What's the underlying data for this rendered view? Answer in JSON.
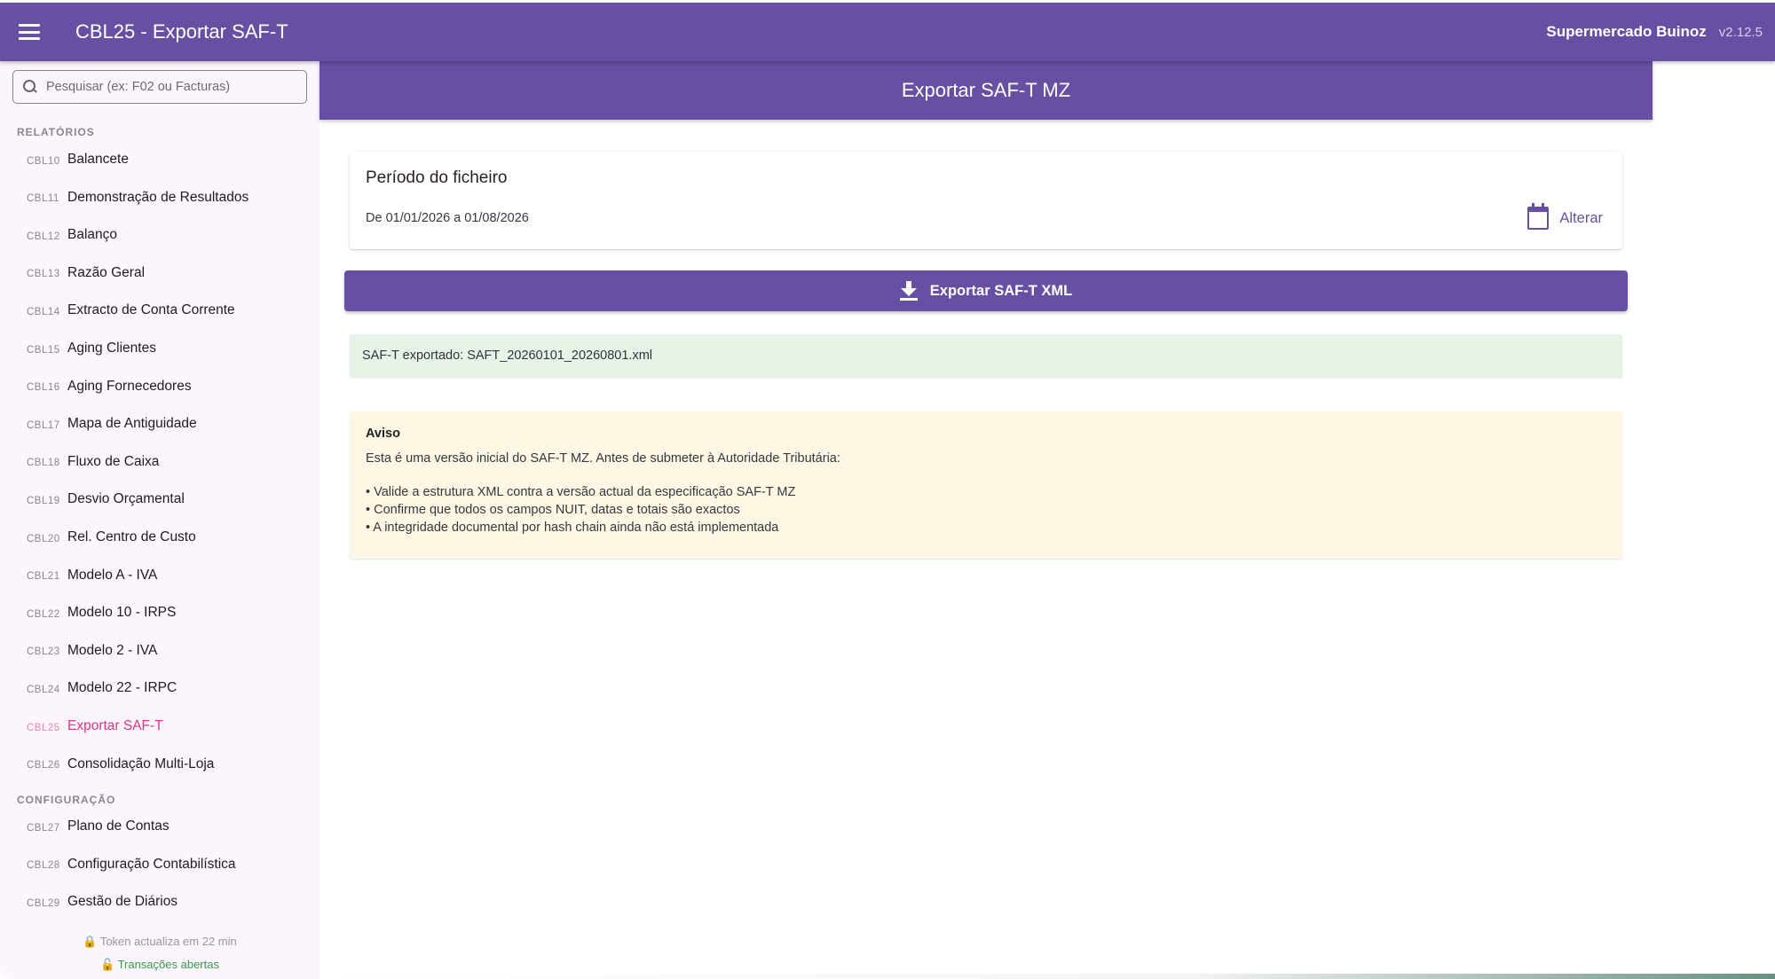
{
  "appbar": {
    "title": "CBL25 - Exportar SAF-T",
    "company": "Supermercado Buinoz",
    "version": "v2.12.5"
  },
  "sidebar": {
    "search_placeholder": "Pesquisar (ex: F02 ou Facturas)",
    "sections": [
      {
        "header": "RELATÓRIOS",
        "items": [
          {
            "code": "CBL10",
            "label": "Balancete"
          },
          {
            "code": "CBL11",
            "label": "Demonstração de Resultados"
          },
          {
            "code": "CBL12",
            "label": "Balanço"
          },
          {
            "code": "CBL13",
            "label": "Razão Geral"
          },
          {
            "code": "CBL14",
            "label": "Extracto de Conta Corrente"
          },
          {
            "code": "CBL15",
            "label": "Aging Clientes"
          },
          {
            "code": "CBL16",
            "label": "Aging Fornecedores"
          },
          {
            "code": "CBL17",
            "label": "Mapa de Antiguidade"
          },
          {
            "code": "CBL18",
            "label": "Fluxo de Caixa"
          },
          {
            "code": "CBL19",
            "label": "Desvio Orçamental"
          },
          {
            "code": "CBL20",
            "label": "Rel. Centro de Custo"
          },
          {
            "code": "CBL21",
            "label": "Modelo A - IVA"
          },
          {
            "code": "CBL22",
            "label": "Modelo 10 - IRPS"
          },
          {
            "code": "CBL23",
            "label": "Modelo 2 - IVA"
          },
          {
            "code": "CBL24",
            "label": "Modelo 22 - IRPC"
          },
          {
            "code": "CBL25",
            "label": "Exportar SAF-T",
            "active": true
          },
          {
            "code": "CBL26",
            "label": "Consolidação Multi-Loja"
          }
        ]
      },
      {
        "header": "CONFIGURAÇÃO",
        "items": [
          {
            "code": "CBL27",
            "label": "Plano de Contas"
          },
          {
            "code": "CBL28",
            "label": "Configuração Contabilística"
          },
          {
            "code": "CBL29",
            "label": "Gestão de Diários"
          }
        ]
      }
    ],
    "footer": {
      "token": "🔒 Token actualiza em 22 min",
      "transactions": "🔓 Transações abertas"
    }
  },
  "main": {
    "page_title": "Exportar SAF-T MZ",
    "period": {
      "title": "Período do ficheiro",
      "range": "De 01/01/2026 a 01/08/2026",
      "change_label": "Alterar"
    },
    "export_button_label": "Exportar SAF-T XML",
    "success_message": "SAF-T exportado: SAFT_20260101_20260801.xml",
    "warning": {
      "title": "Aviso",
      "intro": "Esta é uma versão inicial do SAF-T MZ. Antes de submeter à Autoridade Tributária:",
      "items": [
        "• Valide a estrutura XML contra a versão actual da especificação SAF-T MZ",
        "• Confirme que todos os campos NUIT, datas e totais são exactos",
        "• A integridade documental por hash chain ainda não está implementada"
      ]
    }
  },
  "colors": {
    "primary": "#6750a4",
    "active_nav": "#d63884",
    "success_bg": "#e8f3e7",
    "warning_bg": "#fdf8e4"
  }
}
